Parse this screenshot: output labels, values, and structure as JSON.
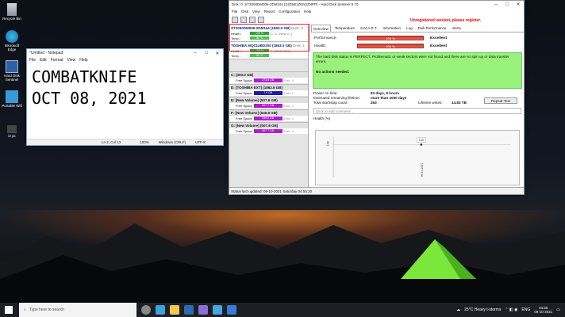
{
  "desktop": {
    "icons": [
      {
        "label": "Recycle Bin"
      },
      {
        "label": "Microsoft Edge"
      },
      {
        "label": "Hard Disk Sentinel"
      },
      {
        "label": "Portable Wifi"
      },
      {
        "label": "i3 pc"
      }
    ]
  },
  "notepad": {
    "title": "*Untitled - Notepad",
    "menu": [
      "File",
      "Edit",
      "Format",
      "View",
      "Help"
    ],
    "line1": "COMBATKNIFE",
    "line2": "OCT 08, 2021",
    "status": {
      "pos": "Ln 2, Col 13",
      "zoom": "100%",
      "eol": "Windows (CRLF)",
      "enc": "UTF-8"
    }
  },
  "hds": {
    "title": "Disk: 0, ST2000DM006-2DM164 [Z4Z5B1ZEN2ZNPP] - Hard Disk Sentinel 5.70",
    "menu": [
      "File",
      "Disk",
      "View",
      "Report",
      "Configuration",
      "Help"
    ],
    "unregistered": "Unregistered version, please register.",
    "disks": [
      {
        "name": "ST2000DM006-2DM164",
        "size": "(1863.0 GB)",
        "tag": "Disk: 0",
        "health": "100 %",
        "hlabel": "Health:",
        "temp": "35 °C",
        "tlabel": "Temp.:",
        "drive": "C: D: [New V...]"
      },
      {
        "name": "TOSHIBA MQ01UBD200",
        "size": "(1863.0 GB)",
        "tag": "Disk: 1",
        "health": "100 %",
        "hlabel": "Health:",
        "temp": "35 °C",
        "tlabel": "Temp.:",
        "drive": "E: [TOSHIBA]"
      }
    ],
    "volumes": [
      {
        "head": "C:",
        "size": "(300.0 GB)",
        "free_label": "Free Space",
        "free": "273.6 GB",
        "disk": "Disk: 0",
        "color": "#b51ad1"
      },
      {
        "head": "D: [TOSHIBA EXT]",
        "size": "(1862.9 GB)",
        "free_label": "Free Space",
        "free": "7.9 GB",
        "disk": "Disk: 1",
        "color": "#1a1ab5"
      },
      {
        "head": "E: [New Volume]",
        "size": "(507.8 GB)",
        "free_label": "Free Space",
        "free": "507.7 GB",
        "disk": "Disk: 0",
        "color": "#b51ad1"
      },
      {
        "head": "F: [New Volume]",
        "size": "(546.8 GB)",
        "free_label": "Free Space",
        "free": "546.8 GB",
        "disk": "Disk: 0",
        "color": "#b51ad1"
      },
      {
        "head": "G: [New Volume]",
        "size": "(507.8 GB)",
        "free_label": "Free Space",
        "free": "507.7 GB",
        "disk": "Disk: 0",
        "color": "#b51ad1"
      }
    ],
    "tabs": [
      "Overview",
      "Temperature",
      "S.M.A.R.T.",
      "Information",
      "Log",
      "Disk Performance",
      "Alerts"
    ],
    "performance": {
      "label": "Performance:",
      "value": "100 %",
      "text": "Excellent"
    },
    "health": {
      "label": "Health:",
      "value": "100 %",
      "text": "Excellent"
    },
    "message": "The hard disk status is PERFECT. Problematic or weak sectors were not found and there are no spin up or data transfer errors.",
    "actions": "No actions needed.",
    "stats": [
      {
        "k": "Power on time:",
        "v": "83 days, 8 hours"
      },
      {
        "k": "Estimated remaining lifetime:",
        "v": "more than 1000 days"
      },
      {
        "k": "Total start/stop count:",
        "v": "263",
        "k2": "Lifetime writes:",
        "v2": "14.83 TB"
      }
    ],
    "report_button": "Repeat Test",
    "comment_placeholder": "Click to add comment ...",
    "health_title": "Health (%)",
    "graph": {
      "y": "100",
      "x": "09-10-2021",
      "point": "100"
    },
    "status": "Status last updated: 09-10-2021 Saturday 04:55:20"
  },
  "taskbar": {
    "search": "Type here to search",
    "weather": "25°C  Heavy t-storms",
    "lang": "ENG",
    "time": "04:55",
    "date": "09-10-2021"
  }
}
